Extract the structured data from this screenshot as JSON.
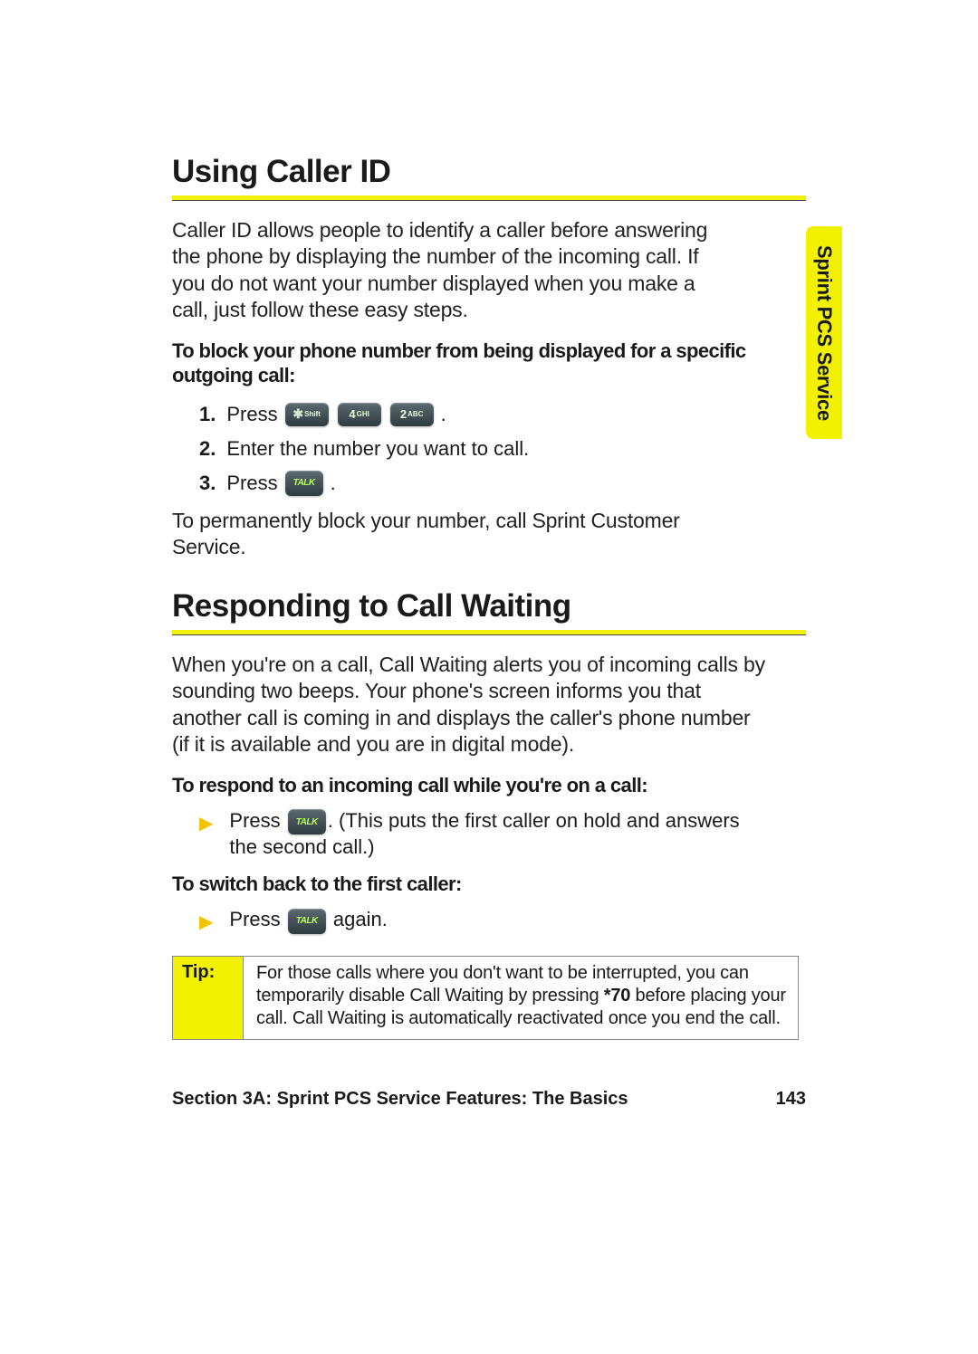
{
  "sideTab": "Sprint PCS Service",
  "section1": {
    "heading": "Using Caller ID",
    "intro": "Caller ID allows people to identify a caller before answering the phone by displaying the number of the incoming call. If you do not want your number displayed when you make a call, just follow these easy steps.",
    "blockSubhead": "To block your phone number from being displayed for a specific outgoing call:",
    "steps": {
      "s1_num": "1.",
      "s1_text": "Press",
      "s1_period": ".",
      "s2_num": "2.",
      "s2_text": "Enter the number you want to call.",
      "s3_num": "3.",
      "s3_text": "Press",
      "s3_period": "."
    },
    "note": "To permanently block your number, call Sprint Customer Service."
  },
  "section2": {
    "heading": "Responding to Call Waiting",
    "intro": "When you're on a call, Call Waiting alerts you of incoming calls by sounding two beeps. Your phone's screen informs you that another call is coming in and displays the caller's phone number (if it is available and you are in digital mode).",
    "respondSubhead": "To respond to an incoming call while you're on a call:",
    "respondStep_pre": "Press",
    "respondStep_post": ". (This puts the first caller on hold and answers the second call.)",
    "switchSubhead": "To switch back to the first caller:",
    "switchStep_pre": "Press",
    "switchStep_post": " again."
  },
  "keys": {
    "star_sub": "Shift",
    "four_big": "4",
    "four_sub": "GHI",
    "two_big": "2",
    "two_sub": "ABC",
    "talk": "TALK"
  },
  "tip": {
    "label": "Tip:",
    "text_pre": "For those calls where you don't want to be interrupted, you can temporarily disable Call Waiting by pressing ",
    "code": "*70",
    "text_post": " before placing your call. Call Waiting is automatically reactivated once you end the call."
  },
  "footer": {
    "section": "Section 3A: Sprint PCS Service Features: The Basics",
    "page": "143"
  }
}
